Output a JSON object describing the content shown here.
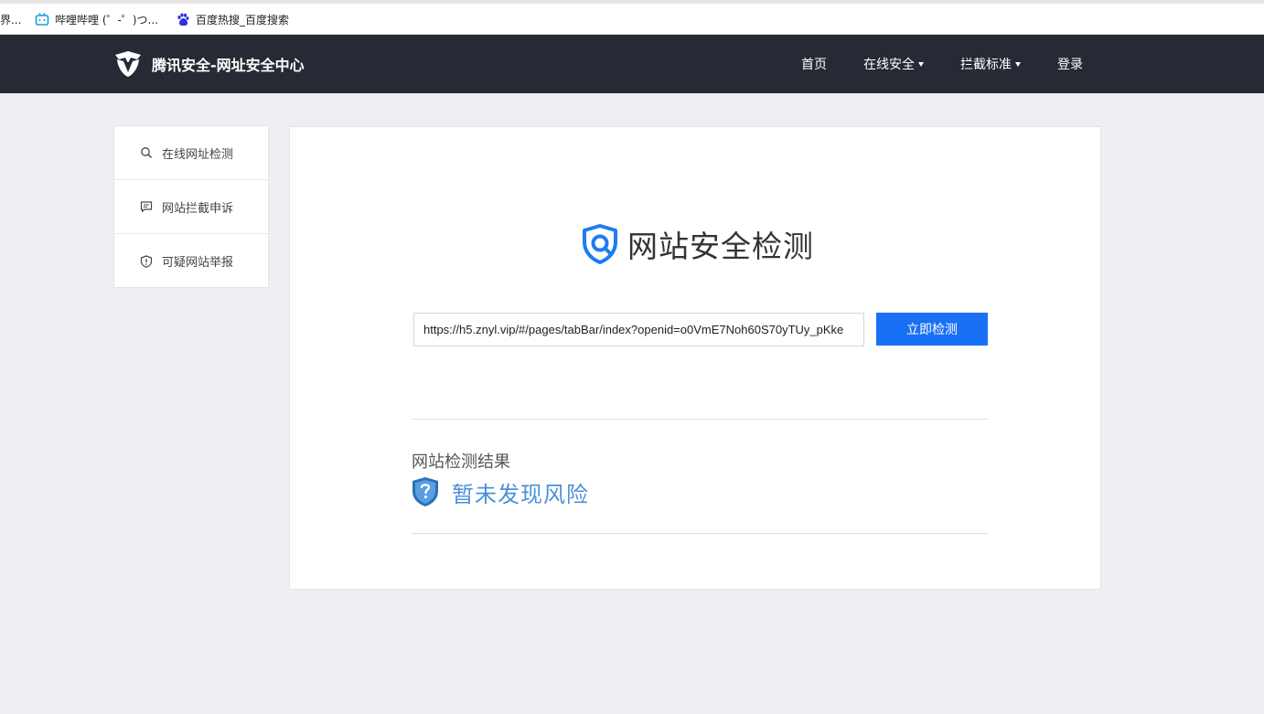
{
  "bookmarks": {
    "items": [
      {
        "label": "界..."
      },
      {
        "label": "哔哩哔哩 (゜-゜)つ..."
      },
      {
        "label": "百度热搜_百度搜索"
      }
    ]
  },
  "nav": {
    "brand": "腾讯安全-网址安全中心",
    "home": "首页",
    "online_security": "在线安全",
    "intercept_standard": "拦截标准",
    "login": "登录"
  },
  "sidebar": {
    "items": [
      {
        "label": "在线网址检测",
        "icon": "search-icon"
      },
      {
        "label": "网站拦截申诉",
        "icon": "comment-icon"
      },
      {
        "label": "可疑网站举报",
        "icon": "shield-icon"
      }
    ]
  },
  "main": {
    "title": "网站安全检测",
    "url_value": "https://h5.znyl.vip/#/pages/tabBar/index?openid=o0VmE7Noh60S70yTUy_pKke",
    "check_button": "立即检测",
    "result_label": "网站检测结果",
    "result_text": "暂未发现风险"
  },
  "colors": {
    "navbar": "#262a34",
    "accent": "#1970f5",
    "result": "#4a90d9",
    "page_bg": "#eeeff3"
  }
}
